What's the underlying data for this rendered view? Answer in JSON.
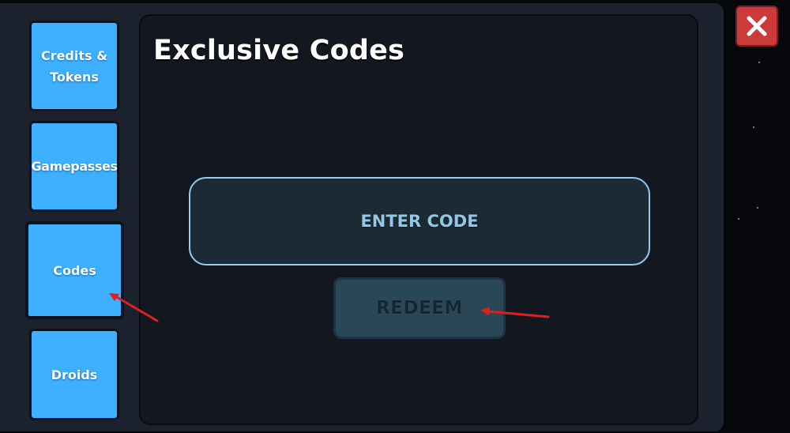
{
  "sidebar": {
    "tabs": [
      {
        "label": "Credits &\nTokens"
      },
      {
        "label": "Gamepasses"
      },
      {
        "label": "Codes"
      },
      {
        "label": "Droids"
      }
    ]
  },
  "main": {
    "title": "Exclusive Codes",
    "code_input": {
      "placeholder": "ENTER CODE",
      "value": ""
    },
    "redeem_button_label": "REDEEM"
  },
  "icons": {
    "close": "close-x-icon"
  },
  "colors": {
    "tab_blue": "#3db0ff",
    "panel_bg": "#131820",
    "input_border": "#8fcde9",
    "redeem_bg": "#2a4757",
    "close_red": "#cc3b3b",
    "annotation_red": "#e01e1e"
  }
}
